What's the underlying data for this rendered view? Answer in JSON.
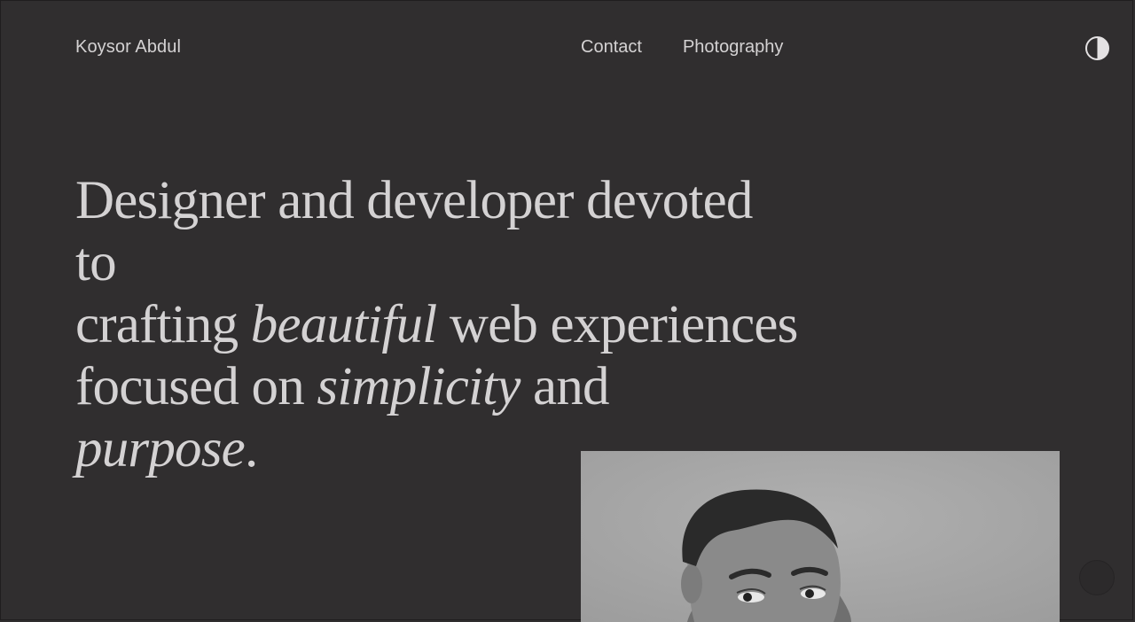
{
  "header": {
    "brand": "Koysor Abdul",
    "nav": [
      {
        "label": "Contact"
      },
      {
        "label": "Photography"
      }
    ],
    "theme_toggle_icon": "half-circle-contrast-icon"
  },
  "hero": {
    "line1": "Designer and developer devoted to",
    "line2_pre": "crafting ",
    "line2_em": "beautiful",
    "line2_post": " web experiences",
    "line3_pre": "focused on ",
    "line3_em1": "simplicity",
    "line3_mid": " and ",
    "line3_em2": "purpose",
    "line3_post": "."
  },
  "colors": {
    "background": "#302e2f",
    "text": "#d4d2d3",
    "photo_bg": "#a5a5a5"
  }
}
